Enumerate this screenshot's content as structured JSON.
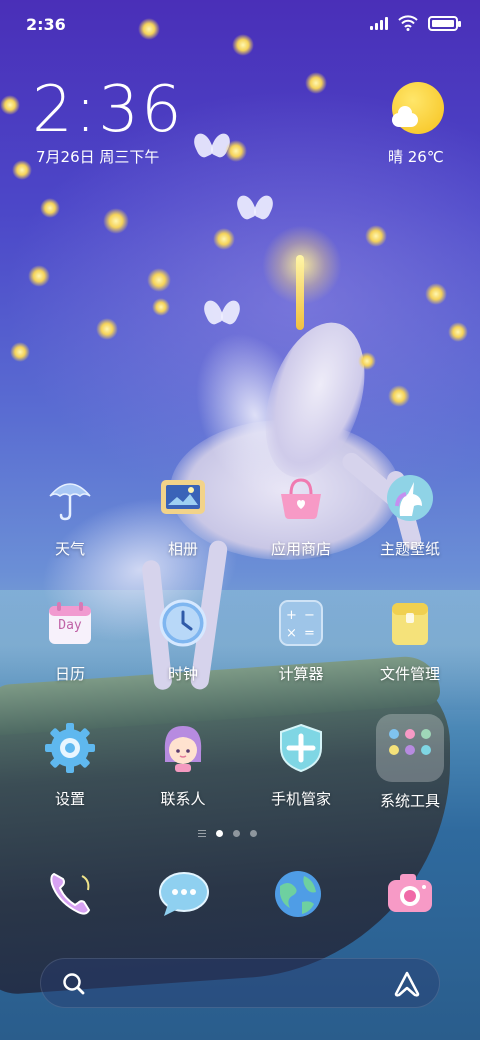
{
  "status_bar": {
    "time": "2:36",
    "battery_level": 1.0,
    "icons": [
      "signal-icon",
      "wifi-icon",
      "battery-icon"
    ]
  },
  "clock_widget": {
    "time": "2:36",
    "date": "7月26日 周三下午"
  },
  "weather_widget": {
    "condition_temp": "晴 26℃",
    "icon": "sunny-cloud-icon"
  },
  "apps": [
    {
      "label": "天气",
      "icon": "umbrella-icon"
    },
    {
      "label": "相册",
      "icon": "photo-frame-icon"
    },
    {
      "label": "应用商店",
      "icon": "shopping-basket-icon"
    },
    {
      "label": "主题壁纸",
      "icon": "unicorn-icon"
    },
    {
      "label": "日历",
      "icon": "calendar-icon",
      "icon_text": "Day"
    },
    {
      "label": "时钟",
      "icon": "clock-icon"
    },
    {
      "label": "计算器",
      "icon": "calculator-icon"
    },
    {
      "label": "文件管理",
      "icon": "folder-icon"
    },
    {
      "label": "设置",
      "icon": "gear-icon"
    },
    {
      "label": "联系人",
      "icon": "contact-girl-icon"
    },
    {
      "label": "手机管家",
      "icon": "shield-icon"
    },
    {
      "label": "系统工具",
      "icon": "folder-grid-icon"
    }
  ],
  "page_indicator": {
    "pages": 2,
    "active": 0
  },
  "dock": [
    {
      "icon": "phone-icon"
    },
    {
      "icon": "message-icon"
    },
    {
      "icon": "browser-globe-icon"
    },
    {
      "icon": "camera-icon"
    }
  ],
  "search_bar": {
    "left_icon": "search-icon",
    "right_icon": "assistant-icon"
  },
  "colors": {
    "background_top": "#4a2fb8",
    "background_bottom": "#2a5d8c",
    "text": "#ffffff",
    "sun": "#f6c21d"
  }
}
